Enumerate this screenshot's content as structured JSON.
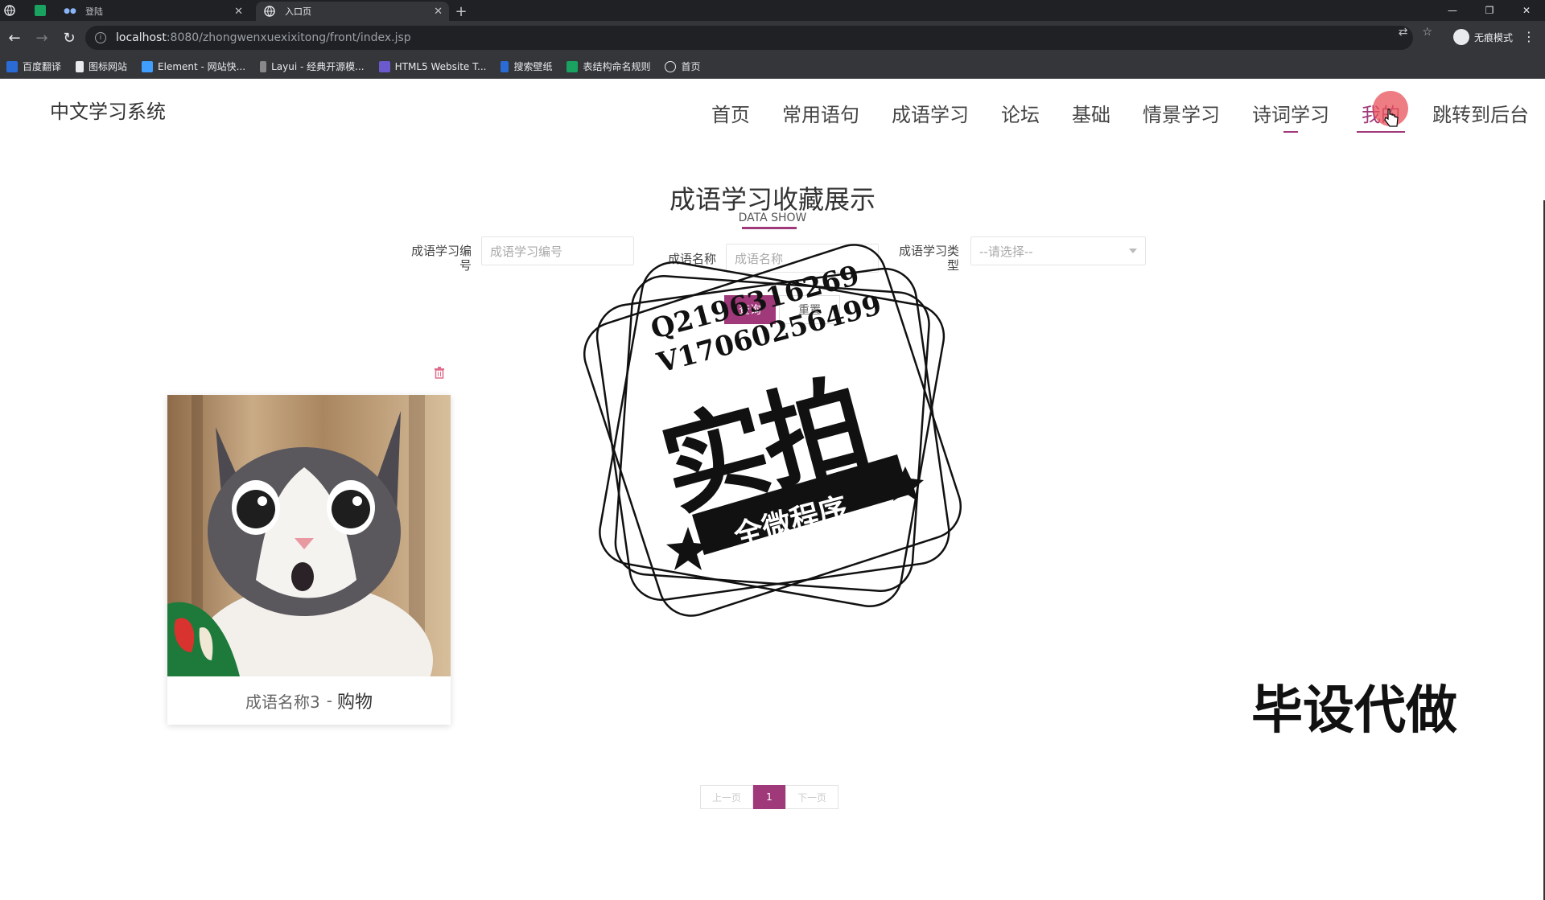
{
  "browser": {
    "tabs": [
      {
        "title": "登陆",
        "active": false
      },
      {
        "title": "入口页",
        "active": true
      }
    ],
    "url_host": "localhost",
    "url_path": ":8080/zhongwenxuexixitong/front/index.jsp",
    "profile_label": "无痕模式",
    "bookmarks": [
      "百度翻译",
      "图标网站",
      "Element - 网站快...",
      "Layui - 经典开源模...",
      "HTML5 Website T...",
      "搜索壁纸",
      "表结构命名规则",
      "首页"
    ]
  },
  "site": {
    "logo": "中文学习系统",
    "nav": [
      {
        "label": "首页",
        "highlighted": false
      },
      {
        "label": "常用语句",
        "highlighted": false
      },
      {
        "label": "成语学习",
        "highlighted": false
      },
      {
        "label": "论坛",
        "highlighted": false
      },
      {
        "label": "基础",
        "highlighted": false
      },
      {
        "label": "情景学习",
        "highlighted": false
      },
      {
        "label": "诗词学习",
        "highlighted": false
      },
      {
        "label": "我的",
        "highlighted": true
      },
      {
        "label": "跳转到后台",
        "highlighted": false
      }
    ],
    "accent_color": "#a0397a"
  },
  "main": {
    "title": "成语学习收藏展示",
    "subtitle": "DATA SHOW",
    "filters": {
      "number_label_line1": "成语学习编",
      "number_label_line2": "号",
      "number_placeholder": "成语学习编号",
      "name_label": "成语名称",
      "name_placeholder": "成语名称",
      "type_label_line1": "成语学习类",
      "type_label_line2": "型",
      "type_selected": "--请选择--",
      "search_button": "查询",
      "reset_button": "重置"
    },
    "card": {
      "name": "成语名称3",
      "separator": "-",
      "category": "购物"
    },
    "pagination": {
      "prev": "上一页",
      "current": "1",
      "next": "下一页"
    }
  },
  "watermark": {
    "qq": "Q2196316269",
    "vx": "V17060256499",
    "big": "实拍",
    "ribbon": "全微程序",
    "corner": "毕设代做"
  }
}
